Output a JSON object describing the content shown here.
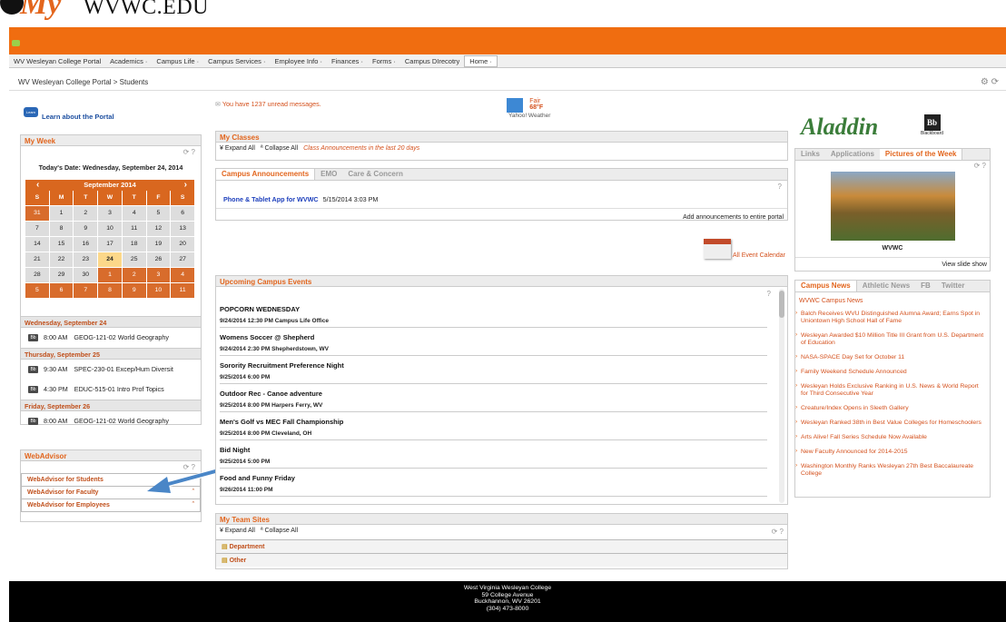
{
  "logo": {
    "text": ".EDU",
    "site": "WVWC"
  },
  "nav": {
    "items": [
      "WV Wesleyan College Portal",
      "Academics ·",
      "Campus Life ·",
      "Campus Services ·",
      "Employee Info ·",
      "Finances ·",
      "Forms ·",
      "Campus DIrecotry",
      "Home ·"
    ]
  },
  "breadcrumb": "WV Wesleyan College Portal > Students",
  "learn": "Learn about the Portal",
  "messages": "You have 1237 unread messages.",
  "weather": {
    "cond": "Fair",
    "temp": "68°F",
    "src": "Yahoo! Weather"
  },
  "myweek": {
    "title": "My Week",
    "today": "Today's Date:  Wednesday, September 24, 2014",
    "month": "September 2014",
    "dow": [
      "S",
      "M",
      "T",
      "W",
      "T",
      "F",
      "S"
    ],
    "rows": [
      [
        "31",
        "1",
        "2",
        "3",
        "4",
        "5",
        "6"
      ],
      [
        "7",
        "8",
        "9",
        "10",
        "11",
        "12",
        "13"
      ],
      [
        "14",
        "15",
        "16",
        "17",
        "18",
        "19",
        "20"
      ],
      [
        "21",
        "22",
        "23",
        "24",
        "25",
        "26",
        "27"
      ],
      [
        "28",
        "29",
        "30",
        "1",
        "2",
        "3",
        "4"
      ],
      [
        "5",
        "6",
        "7",
        "8",
        "9",
        "10",
        "11"
      ]
    ],
    "days": [
      {
        "head": "Wednesday, September 24",
        "events": [
          {
            "time": "8:00 AM",
            "name": "GEOG-121-02 World Geography"
          }
        ]
      },
      {
        "head": "Thursday, September 25",
        "events": [
          {
            "time": "9:30 AM",
            "name": "SPEC-230-01 Excep/Hum Diversit"
          },
          {
            "time": "4:30 PM",
            "name": "EDUC-515-01 Intro Prof Topics"
          }
        ]
      },
      {
        "head": "Friday, September 26",
        "events": [
          {
            "time": "8:00 AM",
            "name": "GEOG-121-02 World Geography"
          }
        ]
      }
    ]
  },
  "webadvisor": {
    "title": "WebAdvisor",
    "items": [
      "WebAdvisor for Students",
      "WebAdvisor for Faculty",
      "WebAdvisor for Employees"
    ]
  },
  "classes": {
    "title": "My Classes",
    "expand": "Expand All",
    "collapse": "Collapse All",
    "note": "Class Announcements in the last 20 days"
  },
  "announce": {
    "tabs": [
      "Campus Announcements",
      "EMO",
      "Care & Concern"
    ],
    "item": "Phone & Tablet App for WVWC",
    "date": "5/15/2014 3:03 PM",
    "add": "Add announcements to entire portal"
  },
  "calendarLink": "All Event Calendar",
  "events": {
    "title": "Upcoming Campus Events",
    "items": [
      {
        "t": "POPCORN WEDNESDAY",
        "d": "9/24/2014 12:30 PM Campus Life Office"
      },
      {
        "t": "Womens Soccer @ Shepherd",
        "d": "9/24/2014 2:30 PM Shepherdstown, WV"
      },
      {
        "t": "Sorority Recruitment Preference Night",
        "d": "9/25/2014 6:00 PM"
      },
      {
        "t": "Outdoor Rec - Canoe adventure",
        "d": "9/25/2014 8:00 PM Harpers Ferry, WV"
      },
      {
        "t": "Men's Golf vs MEC Fall Championship",
        "d": "9/25/2014 8:00 PM Cleveland, OH"
      },
      {
        "t": "Bid Night",
        "d": "9/25/2014 5:00 PM"
      },
      {
        "t": "Food and Funny Friday",
        "d": "9/26/2014 11:00 PM"
      }
    ]
  },
  "teams": {
    "title": "My Team Sites",
    "expand": "Expand All",
    "collapse": "Collapse All",
    "items": [
      "Department",
      "Other"
    ]
  },
  "right": {
    "aladdin": "Aladdin",
    "bbSub": "Blackboard",
    "tabs": [
      "Links",
      "Applications",
      "Pictures of the Week"
    ],
    "caption": "WVWC",
    "slideshow": "View slide show"
  },
  "news": {
    "tabs": [
      "Campus News",
      "Athletic News",
      "FB",
      "Twitter"
    ],
    "title": "WVWC Campus News",
    "items": [
      "Balch Receives WVU Distinguished Alumna Award; Earns Spot in Uniontown High School Hall of Fame",
      "Wesleyan Awarded $10 Million Title III Grant from U.S. Department of Education",
      "NASA-SPACE Day Set for October 11",
      "Family Weekend Schedule Announced",
      "Wesleyan Holds Exclusive Ranking in U.S. News & World Report for Third Consecutive Year",
      "Creature/Index Opens in Sleeth Gallery",
      "Wesleyan Ranked 38th in Best Value Colleges for Homeschoolers",
      "Arts Alive! Fall Series Schedule Now Available",
      "New Faculty Announced for 2014-2015",
      "Washington Monthly Ranks Wesleyan 27th Best Baccalaureate College"
    ]
  },
  "footer": [
    "West Virginia Wesleyan College",
    "59 College Avenue",
    "Buckhannon, WV  26201",
    "(304) 473-8000"
  ]
}
